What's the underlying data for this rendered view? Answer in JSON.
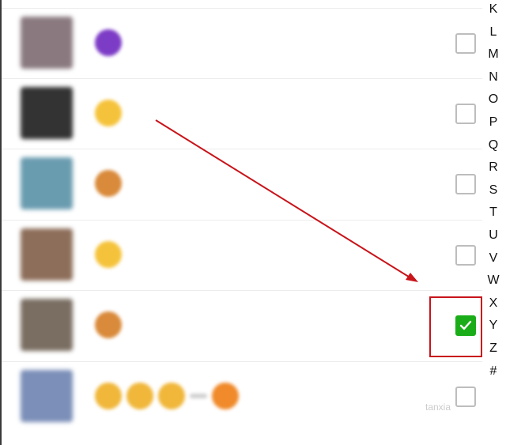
{
  "index_letters": [
    "K",
    "L",
    "M",
    "N",
    "O",
    "P",
    "Q",
    "R",
    "S",
    "T",
    "U",
    "V",
    "W",
    "X",
    "Y",
    "Z",
    "#"
  ],
  "contacts": [
    {
      "avatar_color": "#8a7a80",
      "emoji_colors": [
        "#7d3cc6"
      ],
      "checked": false
    },
    {
      "avatar_color": "#333333",
      "emoji_colors": [
        "#f5c33b"
      ],
      "checked": false
    },
    {
      "avatar_color": "#6a9cb0",
      "emoji_colors": [
        "#d98a3a"
      ],
      "checked": false
    },
    {
      "avatar_color": "#8d6e5a",
      "emoji_colors": [
        "#f5c33b"
      ],
      "checked": false
    },
    {
      "avatar_color": "#7a6e62",
      "emoji_colors": [
        "#d98a3a"
      ],
      "checked": true
    },
    {
      "avatar_color": "#7b8fb8",
      "emoji_colors": [
        "#f0b73a",
        "#f0b73a",
        "#f0b73a",
        "#f08a2a"
      ],
      "checked": false
    }
  ],
  "watermark": "tanxia",
  "colors": {
    "check_green": "#1aad19",
    "annotation_red": "#c8141a"
  }
}
